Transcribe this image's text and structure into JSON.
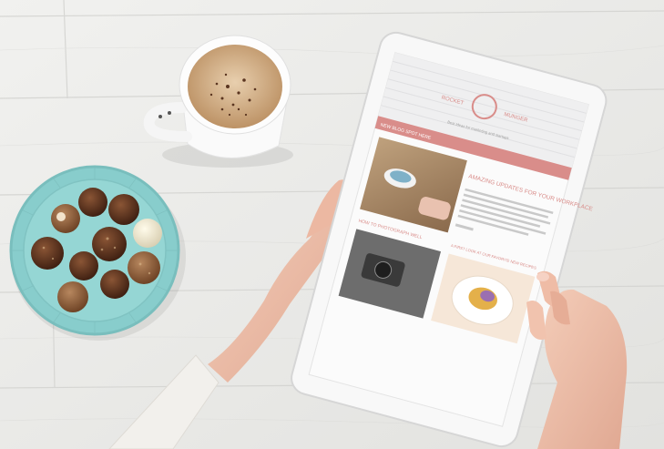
{
  "scene": {
    "description_free": true,
    "tablet": {
      "logo_text_line1": "ROCKET",
      "logo_text_line2": "MUNGER",
      "tagline": "Best Ideas for marketing and startups",
      "nav_bar": "NEW BLOG SPOT HERE",
      "headline_1": "AMAZING UPDATES FOR YOUR WORKPLACE",
      "headline_2": "HOW TO PHOTOGRAPH WELL",
      "headline_3": "A FIRST LOOK AT OUR FAVORITE NEW RECIPES"
    },
    "colors": {
      "wood": "#ececea",
      "plate": "#8fd0cf",
      "accent": "#d98d8a",
      "coffee": "#c9a57b"
    }
  }
}
